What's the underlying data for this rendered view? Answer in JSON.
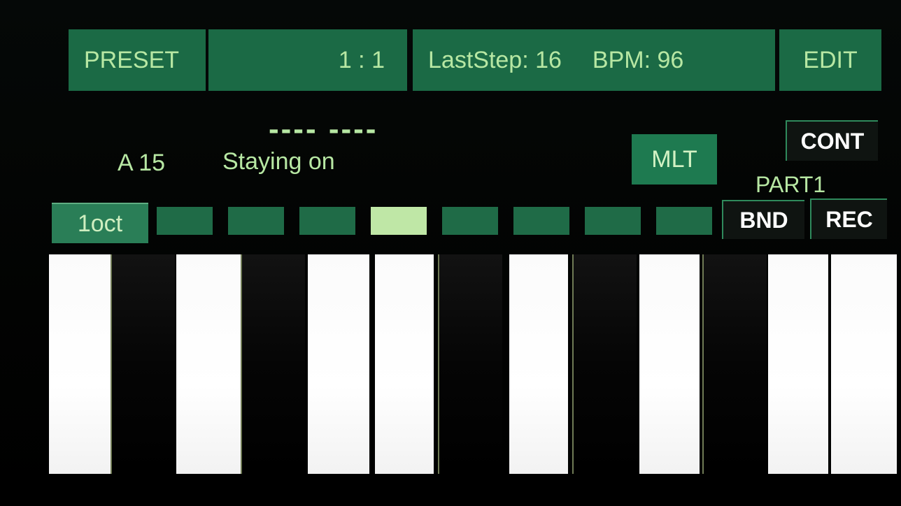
{
  "topbar": {
    "preset_label": "PRESET",
    "position": "1 : 1",
    "last_step": "LastStep: 16",
    "bpm": "BPM: 96",
    "edit_label": "EDIT"
  },
  "display": {
    "dashes": "---- ----",
    "note": "A 15",
    "status": "Staying on"
  },
  "buttons": {
    "mlt": "MLT",
    "cont": "CONT",
    "part": "PART1",
    "bnd": "BND",
    "rec": "REC",
    "oct": "1oct"
  },
  "steps": {
    "count": 8,
    "active_index": 3
  },
  "keys": [
    "white",
    "black",
    "white",
    "black",
    "white",
    "white",
    "black",
    "white",
    "black",
    "white",
    "black",
    "white",
    "white"
  ],
  "colors": {
    "panel_green": "#1b6a45",
    "text_green": "#b7e7a3",
    "step_active": "#bfe7a6"
  }
}
